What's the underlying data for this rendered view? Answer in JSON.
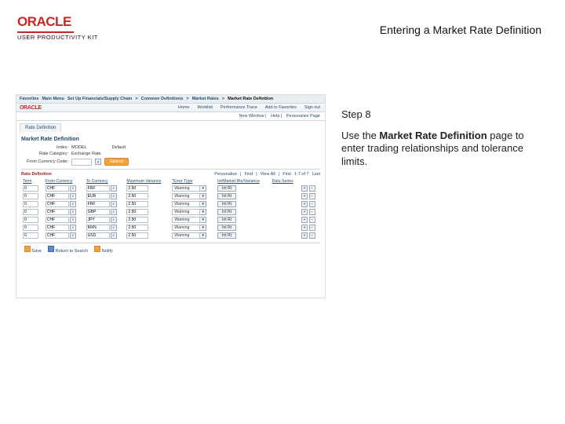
{
  "header": {
    "logo_text": "ORACLE",
    "upk_text": "USER PRODUCTIVITY KIT",
    "page_title": "Entering a Market Rate Definition"
  },
  "instruction": {
    "step_label": "Step 8",
    "pre_text": "Use the ",
    "bold_text": "Market Rate Definition",
    "post_text": " page to enter trading relationships and tolerance limits."
  },
  "app": {
    "breadcrumb": [
      "Favorites",
      "Main Menu",
      "Set Up Financials/Supply Chain",
      "Common Definitions",
      "Market Rates",
      "Market Rate Definition"
    ],
    "nav_links": [
      "Home",
      "Worklist",
      "Performance Trace",
      "Add to Favorites",
      "Sign out"
    ],
    "sublinks": [
      "New Window",
      "Help",
      "Personalize Page"
    ],
    "tab_label": "Rate Definition",
    "section_title": "Market Rate Definition",
    "fields": {
      "index_label": "Index:",
      "index_value": "MODEL",
      "index_default": "Default",
      "rate_cat_label": "Rate Category:",
      "rate_cat_value": "Exchange Rate",
      "from_cur_label": "From Currency Code:",
      "search_label": "Search"
    },
    "rates_title": "Rate Definition",
    "pager": {
      "pers": "Personalize",
      "find": "Find",
      "viewall": "View All",
      "range": "1-7 of 7",
      "first": "First",
      "last": "Last"
    },
    "columns": [
      "Term",
      "From Currency",
      "To Currency",
      "Maximum Variance",
      "*Error Type",
      "Int/Market Rts/Variance",
      "Data Series"
    ],
    "rows": [
      {
        "term": "0",
        "from": "CHF",
        "to": "FRF",
        "var": "2.50",
        "err": "Warning",
        "btn": "Int Rt"
      },
      {
        "term": "0",
        "from": "CHF",
        "to": "EUR",
        "var": "2.50",
        "err": "Warning",
        "btn": "Int Rt"
      },
      {
        "term": "0",
        "from": "CHF",
        "to": "FRF",
        "var": "2.50",
        "err": "Warning",
        "btn": "Int Rt"
      },
      {
        "term": "0",
        "from": "CHF",
        "to": "GBP",
        "var": "2.50",
        "err": "Warning",
        "btn": "Int Rt"
      },
      {
        "term": "0",
        "from": "CHF",
        "to": "JPY",
        "var": "2.50",
        "err": "Warning",
        "btn": "Int Rt"
      },
      {
        "term": "0",
        "from": "CHF",
        "to": "MXN",
        "var": "2.50",
        "err": "Warning",
        "btn": "Int Rt"
      },
      {
        "term": "0",
        "from": "CHF",
        "to": "USD",
        "var": "2.50",
        "err": "Warning",
        "btn": "Int Rt"
      }
    ],
    "toolbar": {
      "save": "Save",
      "return": "Return to Search",
      "notify": "Notify"
    }
  }
}
